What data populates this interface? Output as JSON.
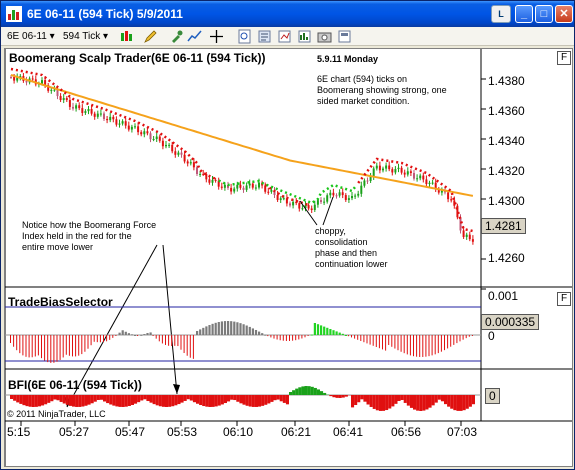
{
  "window": {
    "title": "6E 06-11  (594 Tick)  5/9/2011",
    "link_label": "L",
    "minimize_label": "_",
    "maximize_label": "□",
    "close_label": "✕"
  },
  "toolbar": {
    "instrument": "6E 06-11",
    "period": "594 Tick"
  },
  "price_panel": {
    "title": "Boomerang Scalp Trader(6E 06-11 (594 Tick))",
    "y_labels": [
      "1.4380",
      "1.4360",
      "1.4340",
      "1.4320",
      "1.4300",
      "1.4260"
    ],
    "last_price": "1.4281",
    "f_label": "F",
    "note_date": "5.9.11 Monday",
    "note_top": [
      "6E chart (594) ticks on",
      "Boomerang showing strong, one",
      "sided market condition."
    ],
    "note_left": [
      "Notice how the Boomerang Force",
      "Index held in the red for the",
      "entire move lower"
    ],
    "note_mid": [
      "choppy,",
      "consolidation",
      "phase and then",
      "continuation lower"
    ]
  },
  "tbs_panel": {
    "title": "TradeBiasSelector",
    "y_top": "0.001",
    "y_zero": "0",
    "value": "0.000335",
    "f_label": "F"
  },
  "bfi_panel": {
    "title": "BFI(6E 06-11 (594 Tick))",
    "value": "0"
  },
  "x_axis": [
    "5:15",
    "05:27",
    "05:47",
    "05:53",
    "06:10",
    "06:21",
    "06:41",
    "06:56",
    "07:03"
  ],
  "copyright": "© 2011 NinjaTrader, LLC",
  "colors": {
    "bull": "#1aa11a",
    "bear": "#e01010",
    "ma_orange": "#f5a21b",
    "dotted_red": "#e01010",
    "dotted_green": "#19c419",
    "candle_pink": "#c0587a",
    "histo_gray": "#7b7b7b",
    "histo_green": "#22d422",
    "band_blue": "#2020a0"
  }
}
